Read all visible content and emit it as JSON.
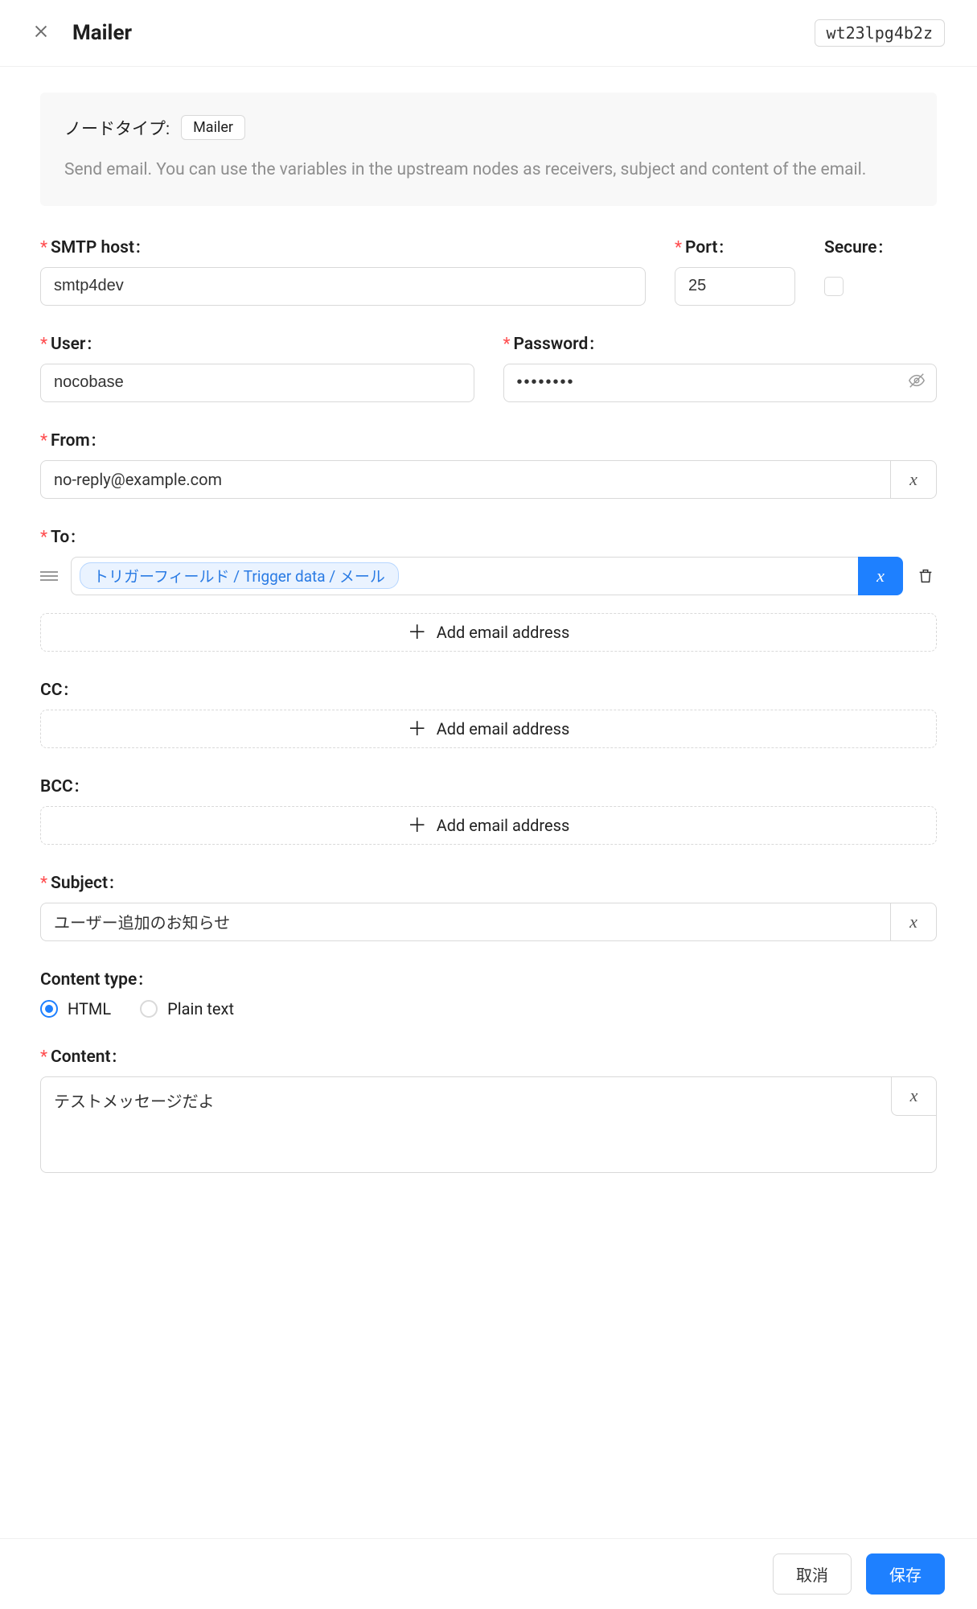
{
  "header": {
    "title": "Mailer",
    "node_id": "wt23lpg4b2z"
  },
  "info": {
    "node_type_label": "ノードタイプ:",
    "node_type_value": "Mailer",
    "description": "Send email. You can use the variables in the upstream nodes as receivers, subject and content of the email."
  },
  "fields": {
    "smtp_host": {
      "label": "SMTP host",
      "value": "smtp4dev",
      "required": true
    },
    "port": {
      "label": "Port",
      "value": "25",
      "required": true
    },
    "secure": {
      "label": "Secure",
      "checked": false,
      "required": false
    },
    "user": {
      "label": "User",
      "value": "nocobase",
      "required": true
    },
    "password": {
      "label": "Password",
      "value": "••••••••",
      "required": true
    },
    "from": {
      "label": "From",
      "value": "no-reply@example.com",
      "required": true
    },
    "to": {
      "label": "To",
      "required": true,
      "items": [
        {
          "chip": "トリガーフィールド / Trigger data / メール"
        }
      ],
      "add_label": "Add email address"
    },
    "cc": {
      "label": "CC",
      "required": false,
      "add_label": "Add email address"
    },
    "bcc": {
      "label": "BCC",
      "required": false,
      "add_label": "Add email address"
    },
    "subject": {
      "label": "Subject",
      "value": "ユーザー追加のお知らせ",
      "required": true
    },
    "content_type": {
      "label": "Content type",
      "required": false,
      "options": [
        {
          "label": "HTML",
          "checked": true
        },
        {
          "label": "Plain text",
          "checked": false
        }
      ]
    },
    "content": {
      "label": "Content",
      "value": "テストメッセージだよ",
      "required": true
    }
  },
  "footer": {
    "cancel": "取消",
    "save": "保存"
  },
  "glyph": {
    "var": "x",
    "plus": "＋"
  }
}
